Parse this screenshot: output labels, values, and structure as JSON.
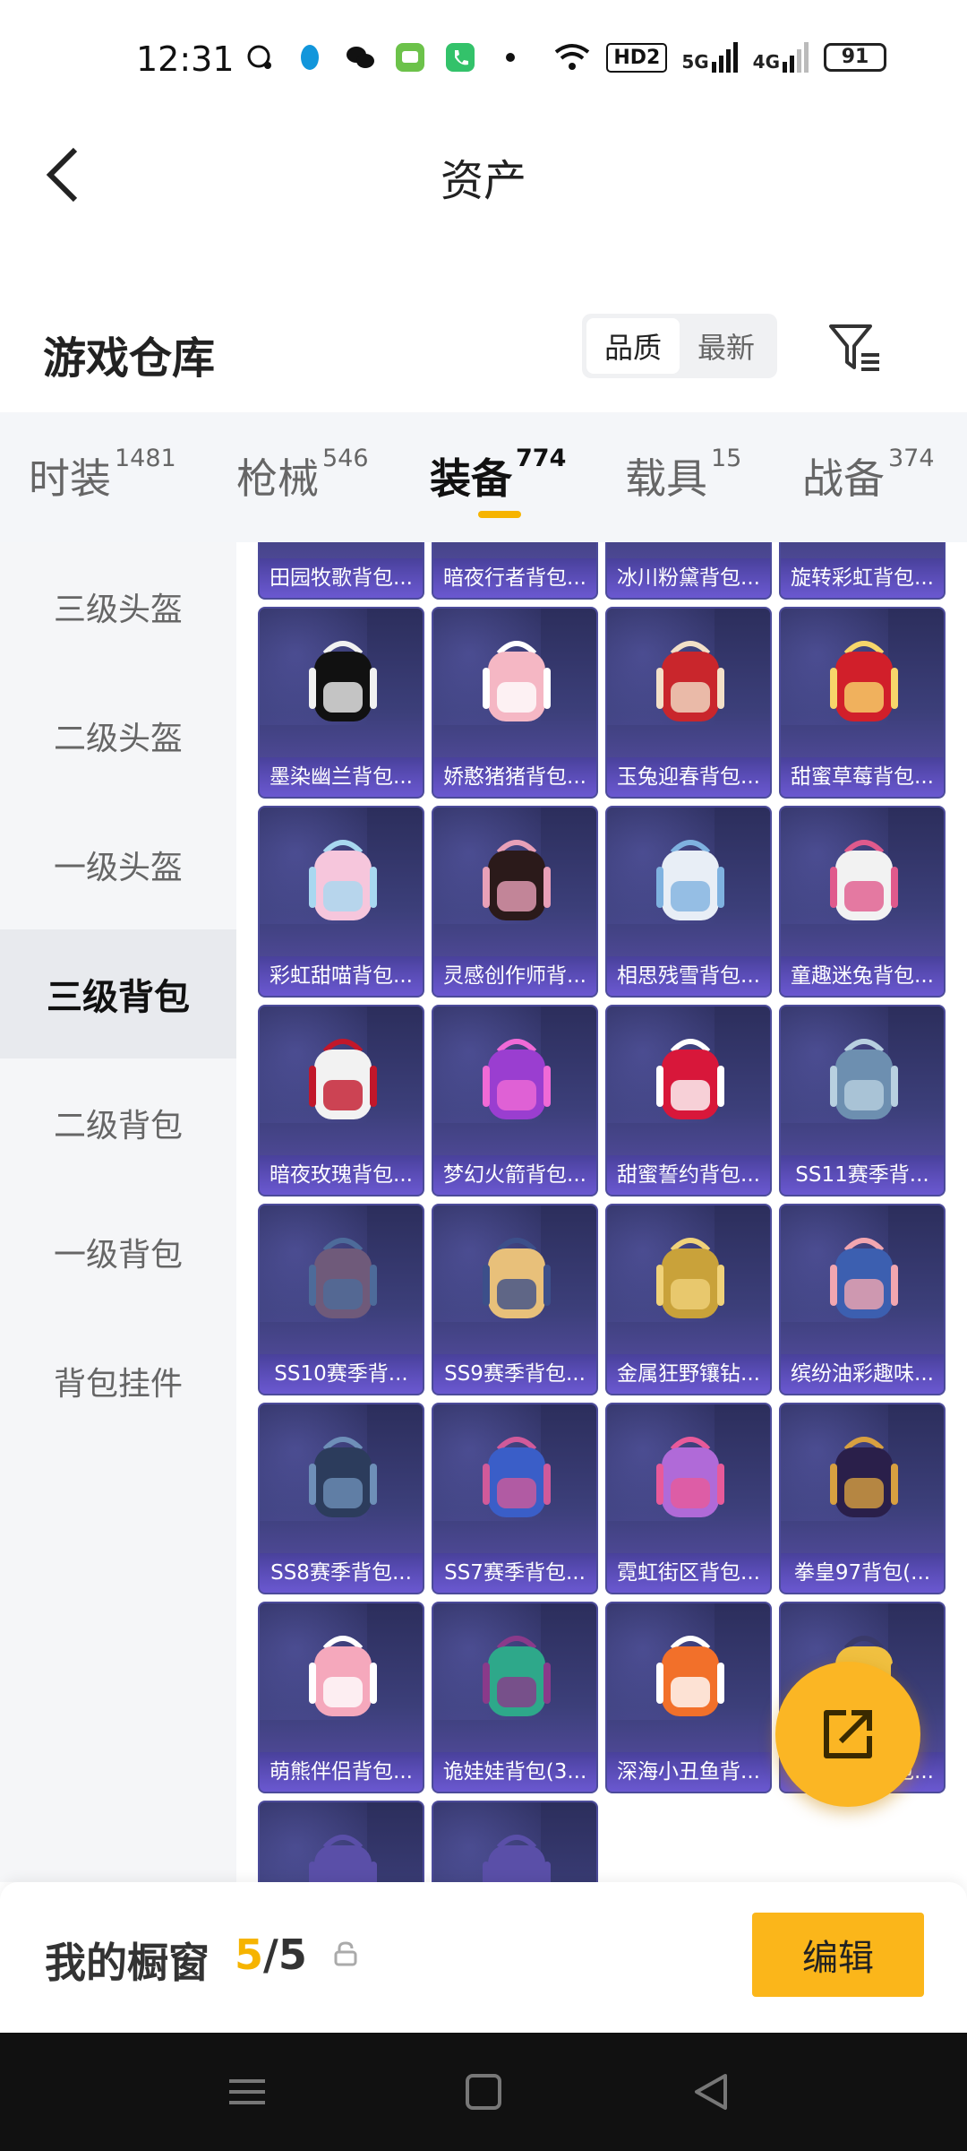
{
  "status_bar": {
    "time": "12:31",
    "network_hd": "HD2",
    "signal_5g": "5G",
    "signal_4g": "4G",
    "battery": "91",
    "icons": [
      "chat-bubble-icon",
      "penguin-icon",
      "wechat-icon",
      "message-icon",
      "phone-icon",
      "dot-icon"
    ]
  },
  "header": {
    "title": "资产"
  },
  "warehouse": {
    "title": "游戏仓库",
    "sort_options": [
      "品质",
      "最新"
    ],
    "active_sort": "品质"
  },
  "tabs": [
    {
      "label": "时装",
      "count": "1481"
    },
    {
      "label": "枪械",
      "count": "546"
    },
    {
      "label": "装备",
      "count": "774"
    },
    {
      "label": "载具",
      "count": "15"
    },
    {
      "label": "战备",
      "count": "374"
    }
  ],
  "sidebar": [
    {
      "label": "三级头盔"
    },
    {
      "label": "二级头盔"
    },
    {
      "label": "一级头盔"
    },
    {
      "label": "三级背包"
    },
    {
      "label": "二级背包"
    },
    {
      "label": "一级背包"
    },
    {
      "label": "背包挂件"
    }
  ],
  "items": [
    {
      "name": "田园牧歌背包..."
    },
    {
      "name": "暗夜行者背包..."
    },
    {
      "name": "冰川粉黛背包..."
    },
    {
      "name": "旋转彩虹背包..."
    },
    {
      "name": "墨染幽兰背包..."
    },
    {
      "name": "娇憨猪猪背包..."
    },
    {
      "name": "玉兔迎春背包..."
    },
    {
      "name": "甜蜜草莓背包..."
    },
    {
      "name": "彩虹甜喵背包..."
    },
    {
      "name": "灵感创作师背..."
    },
    {
      "name": "相思残雪背包..."
    },
    {
      "name": "童趣迷兔背包..."
    },
    {
      "name": "暗夜玫瑰背包..."
    },
    {
      "name": "梦幻火箭背包..."
    },
    {
      "name": "甜蜜誓约背包..."
    },
    {
      "name": "SS11赛季背..."
    },
    {
      "name": "SS10赛季背..."
    },
    {
      "name": "SS9赛季背包..."
    },
    {
      "name": "金属狂野镶钻..."
    },
    {
      "name": "缤纷油彩趣味..."
    },
    {
      "name": "SS8赛季背包..."
    },
    {
      "name": "SS7赛季背包..."
    },
    {
      "name": "霓虹街区背包..."
    },
    {
      "name": "拳皇97背包(..."
    },
    {
      "name": "萌熊伴侣背包..."
    },
    {
      "name": "诡娃娃背包(3..."
    },
    {
      "name": "深海小丑鱼背..."
    },
    {
      "name": "金羽特工背包..."
    },
    {
      "name": ""
    },
    {
      "name": ""
    }
  ],
  "showcase": {
    "label": "我的橱窗",
    "current": "5",
    "separator": "/",
    "total": "5",
    "edit_label": "编辑"
  },
  "colors": {
    "accent": "#f6b400",
    "card_bg": "#3c3f7a",
    "label_bg": "#6a58d0"
  }
}
